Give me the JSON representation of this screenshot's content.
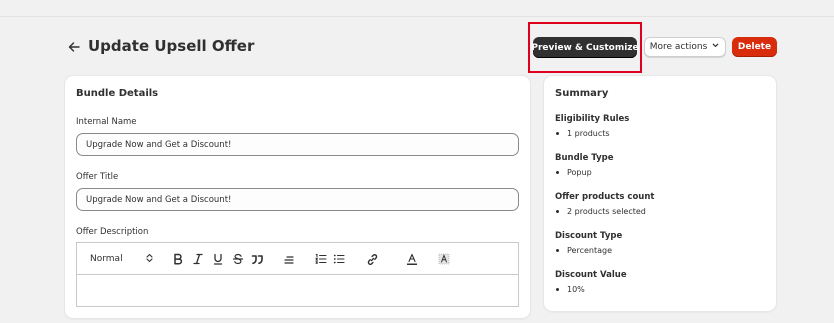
{
  "header": {
    "title": "Update Upsell Offer",
    "preview_label": "Preview & Customize",
    "more_actions_label": "More actions",
    "delete_label": "Delete"
  },
  "bundle_details": {
    "title": "Bundle Details",
    "internal_name": {
      "label": "Internal Name",
      "value": "Upgrade Now and Get a Discount!"
    },
    "offer_title": {
      "label": "Offer Title",
      "value": "Upgrade Now and Get a Discount!"
    },
    "offer_description": {
      "label": "Offer Description",
      "value": ""
    },
    "editor_toolbar": {
      "format_selected": "Normal",
      "buttons": [
        "bold-icon",
        "italic-icon",
        "underline-icon",
        "strikethrough-icon",
        "quote-icon",
        "align-icon",
        "ordered-list-icon",
        "bullet-list-icon",
        "link-icon",
        "text-color-icon",
        "background-color-icon"
      ]
    }
  },
  "summary": {
    "title": "Summary",
    "sections": [
      {
        "heading": "Eligibility Rules",
        "item": "1 products"
      },
      {
        "heading": "Bundle Type",
        "item": "Popup"
      },
      {
        "heading": "Offer products count",
        "item": "2 products selected"
      },
      {
        "heading": "Discount Type",
        "item": "Percentage"
      },
      {
        "heading": "Discount Value",
        "item": "10%"
      }
    ]
  },
  "colors": {
    "background": "#f1f1f1",
    "primary_button": "#303030",
    "delete_button": "#d82c0d",
    "highlight_box": "#e0001b"
  }
}
